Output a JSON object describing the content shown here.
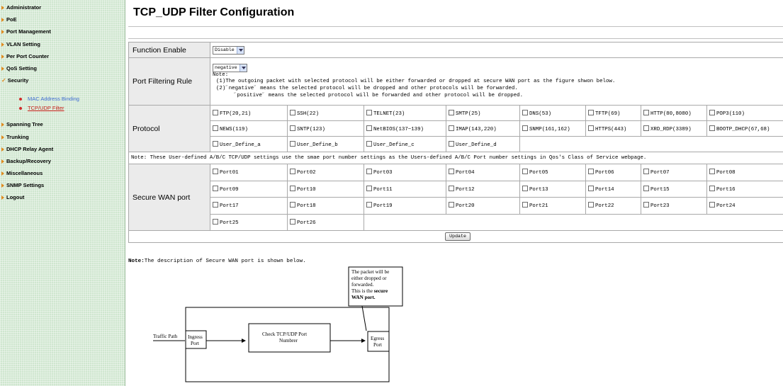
{
  "sidebar": {
    "items": [
      {
        "label": "Administrator"
      },
      {
        "label": "PoE"
      },
      {
        "label": "Port Management"
      },
      {
        "label": "VLAN Setting"
      },
      {
        "label": "Per Port Counter"
      },
      {
        "label": "QoS Setting"
      },
      {
        "label": "Security",
        "expanded": true,
        "children": [
          {
            "label": "MAC Address Binding"
          },
          {
            "label": "TCP/UDP Filter",
            "active": true
          }
        ]
      },
      {
        "label": "Spanning Tree"
      },
      {
        "label": "Trunking"
      },
      {
        "label": "DHCP Relay Agent"
      },
      {
        "label": "Backup/Recovery"
      },
      {
        "label": "Miscellaneous"
      },
      {
        "label": "SNMP Settings"
      },
      {
        "label": "Logout"
      }
    ]
  },
  "page": {
    "title": "TCP_UDP Filter Configuration"
  },
  "function_enable": {
    "label": "Function Enable",
    "value": "Disable"
  },
  "port_filtering": {
    "label": "Port Filtering Rule",
    "value": "negative",
    "note_title": "Note:",
    "note_lines": [
      "(1)The outgoing packet with selected protocol will be either forwarded or dropped at secure WAN port as the figure shwon below.",
      "(2)˝negative˝ means the selected protocol will be dropped and other protocols will be forwarded.",
      "˝positive˝ means the selected protocol will be forwarded and other protocol will be dropped."
    ]
  },
  "protocol": {
    "label": "Protocol",
    "rows": [
      [
        "FTP(20,21)",
        "SSH(22)",
        "TELNET(23)",
        "SMTP(25)",
        "DNS(53)",
        "TFTP(69)",
        "HTTP(80,8080)",
        "POP3(110)"
      ],
      [
        "NEWS(119)",
        "SNTP(123)",
        "NetBIOS(137~139)",
        "IMAP(143,220)",
        "SNMP(161,162)",
        "HTTPS(443)",
        "XRD_RDP(3389)",
        "BOOTP_DHCP(67,68)"
      ],
      [
        "User_Define_a",
        "User_Define_b",
        "User_Define_c",
        "User_Define_d"
      ]
    ]
  },
  "user_define_note": "Note: These User-defined A/B/C TCP/UDP settings use the smae port number settings as the Users-defined A/B/C Port number settings in Qos's Class of Service webpage.",
  "secure_wan": {
    "label": "Secure WAN port",
    "rows": [
      [
        "Port01",
        "Port02",
        "Port03",
        "Port04",
        "Port05",
        "Port06",
        "Port07",
        "Port08"
      ],
      [
        "Port09",
        "Port10",
        "Port11",
        "Port12",
        "Port13",
        "Port14",
        "Port15",
        "Port16"
      ],
      [
        "Port17",
        "Port18",
        "Port19",
        "Port20",
        "Port21",
        "Port22",
        "Port23",
        "Port24"
      ],
      [
        "Port25",
        "Port26"
      ]
    ]
  },
  "update_button": "Update",
  "description_note": {
    "prefix": "Note:",
    "text": "The description of Secure WAN port is shown below."
  },
  "diagram": {
    "traffic_path": "Traffic Path",
    "ingress_1": "Ingress",
    "ingress_2": "Port",
    "check_1": "Check  TCP/UDP Port",
    "check_2": "Numbrer",
    "egress_1": "Egress",
    "egress_2": "Port",
    "callout_1": "The packet will be",
    "callout_2": "either dropped or",
    "callout_3": "forwarded.",
    "callout_4": "This is the ",
    "callout_4b": "secure",
    "callout_5": "WAN port."
  }
}
